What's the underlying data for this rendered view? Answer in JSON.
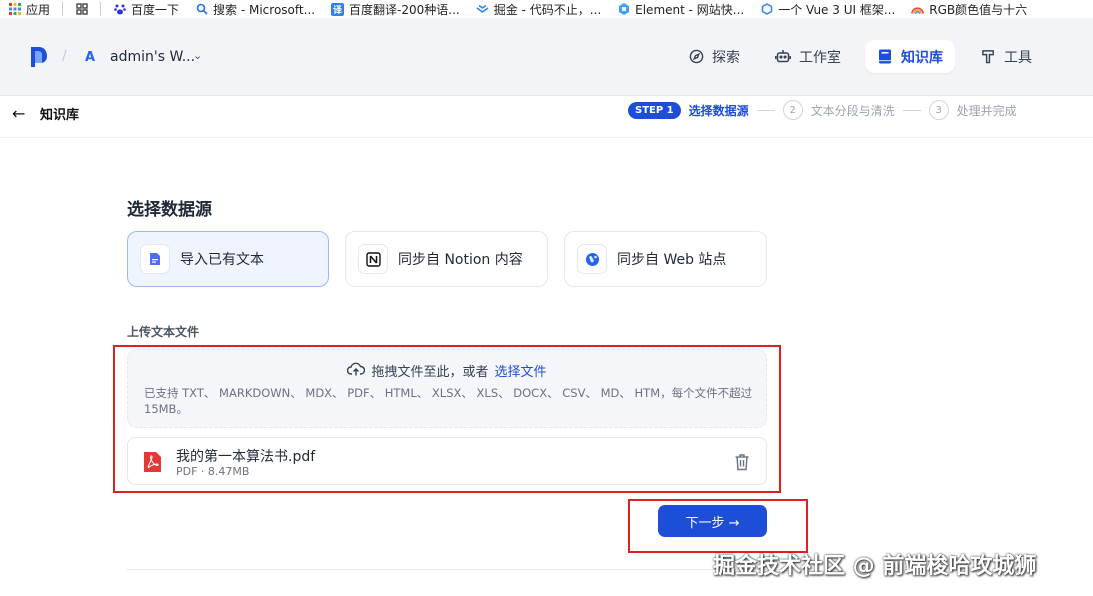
{
  "bookmarks": [
    {
      "label": "应用",
      "icon": "apps-grid-icon",
      "color": "#4285f4"
    },
    {
      "label": "",
      "icon": "grid-icon",
      "color": "#555555"
    },
    {
      "label": "百度一下",
      "icon": "baidu-paw-icon",
      "color": "#2932e1"
    },
    {
      "label": "搜索 - Microsoft...",
      "icon": "search-icon",
      "color": "#1a73e8"
    },
    {
      "label": "百度翻译-200种语...",
      "icon": "translate-icon",
      "color": "#2e7ff0"
    },
    {
      "label": "掘金 - 代码不止，...",
      "icon": "juejin-icon",
      "color": "#1e80ff"
    },
    {
      "label": "Element - 网站快...",
      "icon": "element-icon",
      "color": "#409eff"
    },
    {
      "label": "一个 Vue 3 UI 框架...",
      "icon": "hexagon-icon",
      "color": "#3b82f6"
    },
    {
      "label": "RGB颜色值与十六",
      "icon": "rainbow-icon",
      "color": "#f59e0b"
    }
  ],
  "header": {
    "workspace_badge": "A",
    "workspace_name": "admin's W...",
    "nav": [
      {
        "label": "探索",
        "icon": "compass-icon",
        "active": false
      },
      {
        "label": "工作室",
        "icon": "robot-icon",
        "active": false
      },
      {
        "label": "知识库",
        "icon": "book-icon",
        "active": true
      },
      {
        "label": "工具",
        "icon": "hammer-icon",
        "active": false
      }
    ]
  },
  "subheader": {
    "title": "知识库",
    "steps": [
      {
        "badge": "STEP 1",
        "label": "选择数据源",
        "active": true
      },
      {
        "badge": "2",
        "label": "文本分段与清洗",
        "active": false
      },
      {
        "badge": "3",
        "label": "处理并完成",
        "active": false
      }
    ]
  },
  "main": {
    "section_title": "选择数据源",
    "sources": [
      {
        "label": "导入已有文本",
        "icon": "document-icon",
        "selected": true
      },
      {
        "label": "同步自 Notion 内容",
        "icon": "notion-icon",
        "selected": false
      },
      {
        "label": "同步自 Web 站点",
        "icon": "web-icon",
        "selected": false
      }
    ],
    "upload_title": "上传文本文件",
    "dropzone": {
      "text": "拖拽文件至此，或者",
      "link": "选择文件",
      "hint": "已支持 TXT、 MARKDOWN、 MDX、 PDF、 HTML、 XLSX、 XLS、 DOCX、 CSV、 MD、 HTM，每个文件不超过 15MB。"
    },
    "file": {
      "name": "我的第一本算法书.pdf",
      "meta": "PDF · 8.47MB"
    },
    "next_label": "下一步 →"
  },
  "watermark": "掘金技术社区 @ 前端梭哈攻城狮",
  "colors": {
    "accent": "#1d4ed8",
    "highlight": "#e02020"
  }
}
